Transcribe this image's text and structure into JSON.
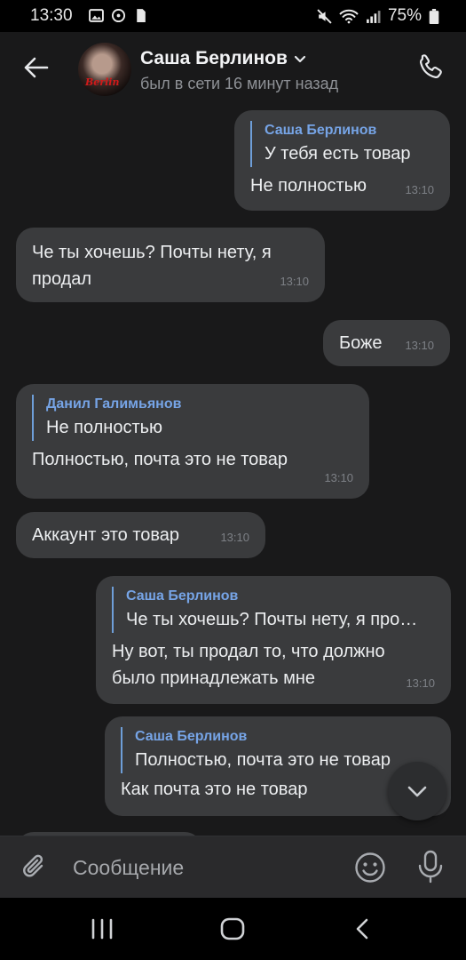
{
  "status_bar": {
    "time": "13:30",
    "battery": "75%"
  },
  "header": {
    "name": "Саша Берлинов",
    "status": "был в сети 16 минут назад",
    "avatar_text": "Berlin"
  },
  "messages": [
    {
      "dir": "out",
      "reply": {
        "author": "Саша Берлинов",
        "text": "У тебя есть товар"
      },
      "text": "Не полностью",
      "time": "13:10"
    },
    {
      "dir": "in",
      "text": "Че ты хочешь? Почты нету, я продал",
      "time": "13:10"
    },
    {
      "dir": "out",
      "text": "Боже",
      "time": "13:10"
    },
    {
      "dir": "in",
      "reply": {
        "author": "Данил Галимьянов",
        "text": "Не полностью"
      },
      "text": "Полностью, почта это не товар",
      "time": "13:10"
    },
    {
      "dir": "in",
      "text": "Аккаунт это товар",
      "time": "13:10"
    },
    {
      "dir": "out",
      "reply": {
        "author": "Саша Берлинов",
        "text": "Че ты хочешь? Почты нету, я про…"
      },
      "text": "Ну вот, ты продал то, что должно было принадлежать мне",
      "time": "13:10"
    },
    {
      "dir": "out",
      "reply": {
        "author": "Саша Берлинов",
        "text": "Полностью, почта это не товар"
      },
      "text": "Как почта это не товар"
    }
  ],
  "composer": {
    "placeholder": "Сообщение"
  },
  "colors": {
    "bubble": "#3a3b3d",
    "background": "#19191a",
    "reply_accent": "#76a4e6"
  },
  "icons": [
    "back-arrow-icon",
    "phone-icon",
    "chevron-down-icon",
    "paperclip-icon",
    "smile-icon",
    "microphone-icon",
    "recent-apps-icon",
    "home-icon",
    "back-icon"
  ]
}
